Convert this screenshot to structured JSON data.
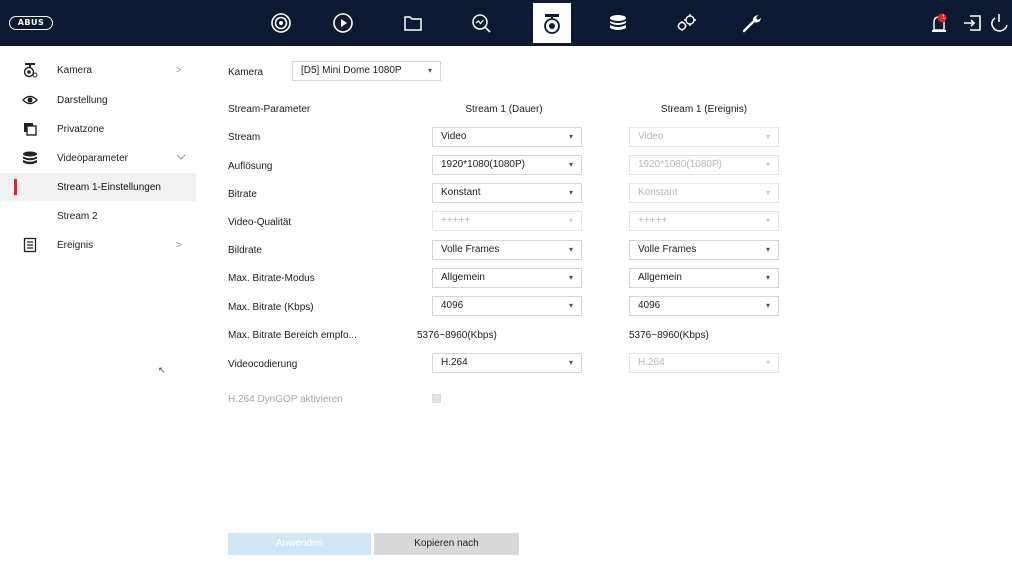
{
  "topbar": {
    "brand": "ABUS",
    "nav_icons": [
      "live-view-icon",
      "playback-icon",
      "file-icon",
      "search-icon",
      "camera-icon",
      "storage-icon",
      "settings-icon",
      "maintenance-icon"
    ],
    "active_nav": "camera-icon",
    "alarm_badge": "1",
    "right_icons": [
      "alarm-icon",
      "logout-icon",
      "power-icon"
    ]
  },
  "sidebar": {
    "items": [
      {
        "label": "Kamera",
        "icon": "camera-icon",
        "chevron": ">"
      },
      {
        "label": "Darstellung",
        "icon": "eye-icon"
      },
      {
        "label": "Privatzone",
        "icon": "privacy-icon"
      },
      {
        "label": "Videoparameter",
        "icon": "database-icon",
        "chevron": "v"
      },
      {
        "label": "Stream 1-Einstellungen"
      },
      {
        "label": "Stream 2"
      },
      {
        "label": "Ereignis",
        "icon": "document-icon",
        "chevron": ">"
      }
    ]
  },
  "form": {
    "camera_label": "Kamera",
    "camera_value": "[D5] Mini Dome 1080P",
    "param_header": "Stream-Parameter",
    "col1_header": "Stream 1 (Dauer)",
    "col2_header": "Stream 1 (Ereignis)",
    "rows": [
      {
        "label": "Stream",
        "v1": "Video",
        "v2": "Video"
      },
      {
        "label": "Auflösung",
        "v1": "1920*1080(1080P)",
        "v2": "1920*1080(1080P)"
      },
      {
        "label": "Bitrate",
        "v1": "Konstant",
        "v2": "Konstant"
      },
      {
        "label": "Video-Qualität",
        "v1": "+++++",
        "v2": "+++++"
      },
      {
        "label": "Bildrate",
        "v1": "Volle Frames",
        "v2": "Volle Frames"
      },
      {
        "label": "Max. Bitrate-Modus",
        "v1": "Allgemein",
        "v2": "Allgemein"
      },
      {
        "label": "Max. Bitrate (Kbps)",
        "v1": "4096",
        "v2": "4096"
      },
      {
        "label": "Max. Bitrate Bereich empfo...",
        "v1": "5376~8960(Kbps)",
        "v2": "5376~8960(Kbps)"
      },
      {
        "label": "Videocodierung",
        "v1": "H.264",
        "v2": "H.264"
      }
    ],
    "dyngop_label": "H.264 DynGOP aktivieren",
    "dyngop_checked": false
  },
  "buttons": {
    "apply": "Anwenden",
    "copy": "Kopieren nach"
  },
  "colors": {
    "topbar": "#0d1832",
    "accent_red": "#e8202a",
    "apply_bg": "#cfe6f5"
  }
}
